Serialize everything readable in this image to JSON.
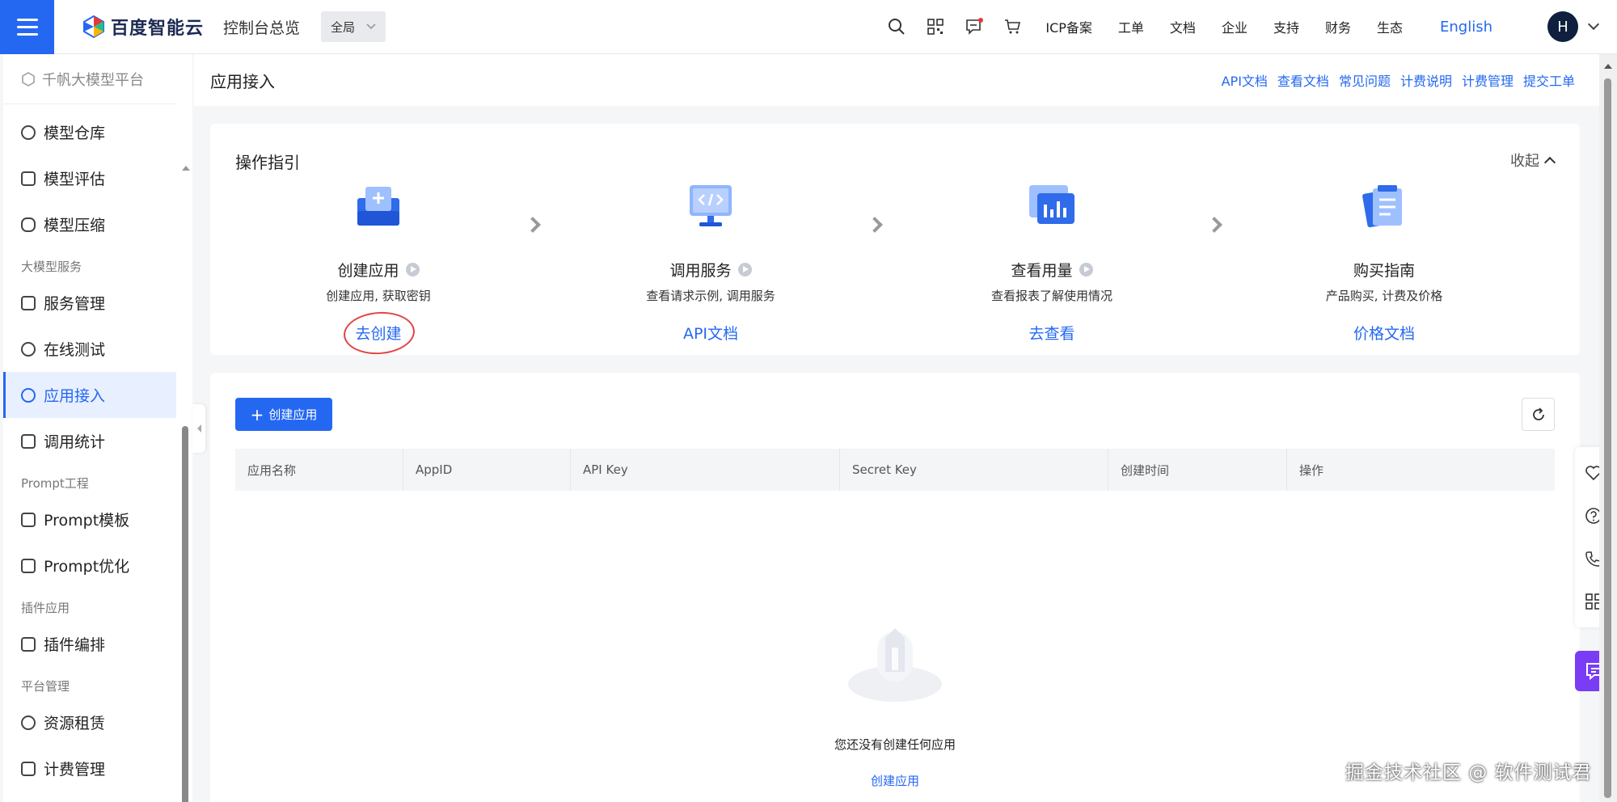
{
  "topbar": {
    "logo_text": "百度智能云",
    "console_link": "控制台总览",
    "region": "全局",
    "links": [
      "ICP备案",
      "工单",
      "文档",
      "企业",
      "支持",
      "财务",
      "生态"
    ],
    "language": "English",
    "avatar_initial": "H",
    "brand_color": "#2468f2"
  },
  "sidebar": {
    "platform": "千帆大模型平台",
    "items_top": [
      "模型仓库",
      "模型评估",
      "模型压缩"
    ],
    "group_service": "大模型服务",
    "items_service": [
      "服务管理",
      "在线测试",
      "应用接入",
      "调用统计"
    ],
    "group_prompt": "Prompt工程",
    "items_prompt": [
      "Prompt模板",
      "Prompt优化"
    ],
    "group_plugin": "插件应用",
    "items_plugin": [
      "插件编排"
    ],
    "group_platform": "平台管理",
    "items_platform": [
      "资源租赁",
      "计费管理"
    ]
  },
  "header": {
    "title": "应用接入",
    "links": [
      "API文档",
      "查看文档",
      "常见问题",
      "计费说明",
      "计费管理",
      "提交工单"
    ]
  },
  "guide": {
    "title": "操作指引",
    "collapse_label": "收起",
    "steps": [
      {
        "title": "创建应用",
        "desc": "创建应用, 获取密钥",
        "link": "去创建"
      },
      {
        "title": "调用服务",
        "desc": "查看请求示例, 调用服务",
        "link": "API文档"
      },
      {
        "title": "查看用量",
        "desc": "查看报表了解使用情况",
        "link": "去查看"
      },
      {
        "title": "购买指南",
        "desc": "产品购买, 计费及价格",
        "link": "价格文档"
      }
    ]
  },
  "list": {
    "create_button": "创建应用",
    "columns": [
      "应用名称",
      "AppID",
      "API Key",
      "Secret Key",
      "创建时间",
      "操作"
    ],
    "empty_text": "您还没有创建任何应用",
    "empty_link": "创建应用"
  },
  "watermark": "掘金技术社区 @ 软件测试君"
}
